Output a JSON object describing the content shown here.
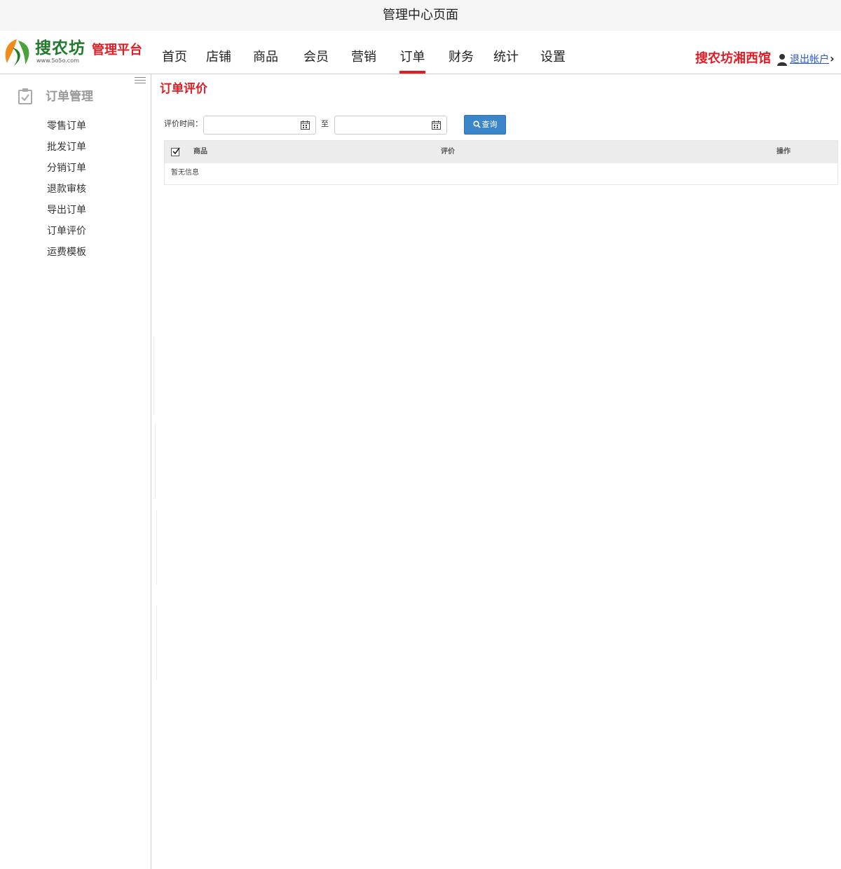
{
  "window": {
    "title": "管理中心页面"
  },
  "brand": {
    "name": "搜农坊",
    "url": "www.5o5o.com",
    "platform": "管理平台"
  },
  "nav": {
    "items": [
      {
        "label": "首页"
      },
      {
        "label": "店铺"
      },
      {
        "label": "商品"
      },
      {
        "label": "会员"
      },
      {
        "label": "营销"
      },
      {
        "label": "订单",
        "active": true
      },
      {
        "label": "财务"
      },
      {
        "label": "统计"
      },
      {
        "label": "设置"
      }
    ],
    "store_name": "搜农坊湘西馆",
    "logout_label": "退出帐户",
    "logout_arrow": "›"
  },
  "sidebar": {
    "section_title": "订单管理",
    "items": [
      {
        "label": "零售订单"
      },
      {
        "label": "批发订单"
      },
      {
        "label": "分销订单"
      },
      {
        "label": "退款审核"
      },
      {
        "label": "导出订单"
      },
      {
        "label": "订单评价"
      },
      {
        "label": "运费模板"
      }
    ]
  },
  "main": {
    "title": "订单评价",
    "filter": {
      "label": "评价时间：",
      "start_value": "",
      "end_value": "",
      "to_label": "至",
      "query_label": "查询"
    },
    "table": {
      "columns": [
        "商品",
        "评价",
        "操作"
      ],
      "rows": [],
      "empty_text": "暂无信息"
    }
  },
  "colors": {
    "accent_red": "#e21c23",
    "button_blue": "#3a86c8",
    "brand_green": "#1f7a2a"
  }
}
